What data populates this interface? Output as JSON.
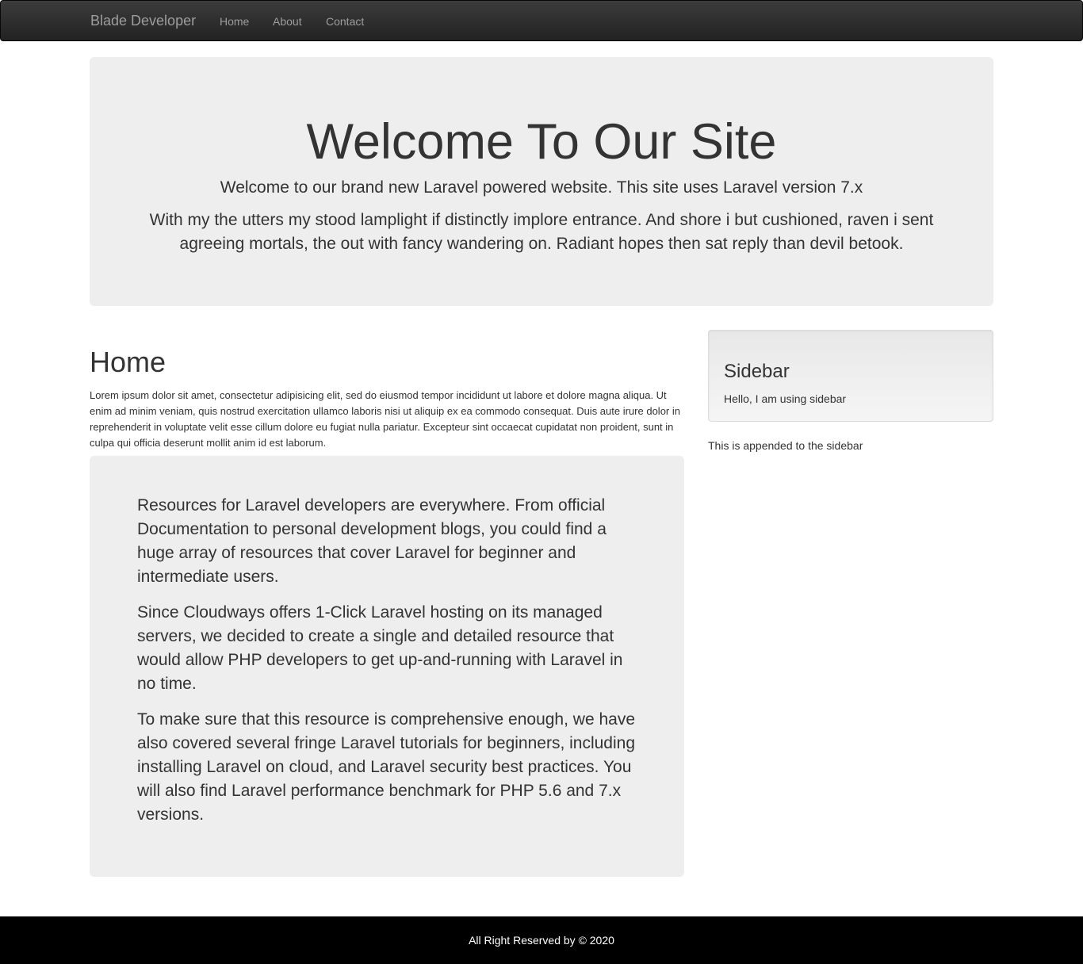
{
  "navbar": {
    "brand": "Blade Developer",
    "links": [
      "Home",
      "About",
      "Contact"
    ]
  },
  "jumbotron": {
    "title": "Welcome To Our Site",
    "lead": "Welcome to our brand new Laravel powered website. This site uses Laravel version 7.x",
    "text": "With my the utters my stood lamplight if distinctly implore entrance. And shore i but cushioned, raven i sent agreeing mortals, the out with fancy wandering on. Radiant hopes then sat reply than devil betook."
  },
  "main": {
    "heading": "Home",
    "body": "Lorem ipsum dolor sit amet, consectetur adipisicing elit, sed do eiusmod tempor incididunt ut labore et dolore magna aliqua. Ut enim ad minim veniam, quis nostrud exercitation ullamco laboris nisi ut aliquip ex ea commodo consequat. Duis aute irure dolor in reprehenderit in voluptate velit esse cillum dolore eu fugiat nulla pariatur. Excepteur sint occaecat cupidatat non proident, sunt in culpa qui officia deserunt mollit anim id est laborum.",
    "resources": [
      "Resources for Laravel developers are everywhere. From official Documentation to personal development blogs, you could find a huge array of resources that cover Laravel for beginner and intermediate users.",
      "Since Cloudways offers 1-Click Laravel hosting on its managed servers, we decided to create a single and detailed resource that would allow PHP developers to get up-and-running with Laravel in no time.",
      "To make sure that this resource is comprehensive enough, we have also covered several fringe Laravel tutorials for beginners, including installing Laravel on cloud, and Laravel security best practices. You will also find Laravel performance benchmark for PHP 5.6 and 7.x versions."
    ]
  },
  "sidebar": {
    "title": "Sidebar",
    "text": "Hello, I am using sidebar",
    "appended": "This is appended to the sidebar"
  },
  "footer": {
    "text": "All Right Reserved by © 2020"
  }
}
